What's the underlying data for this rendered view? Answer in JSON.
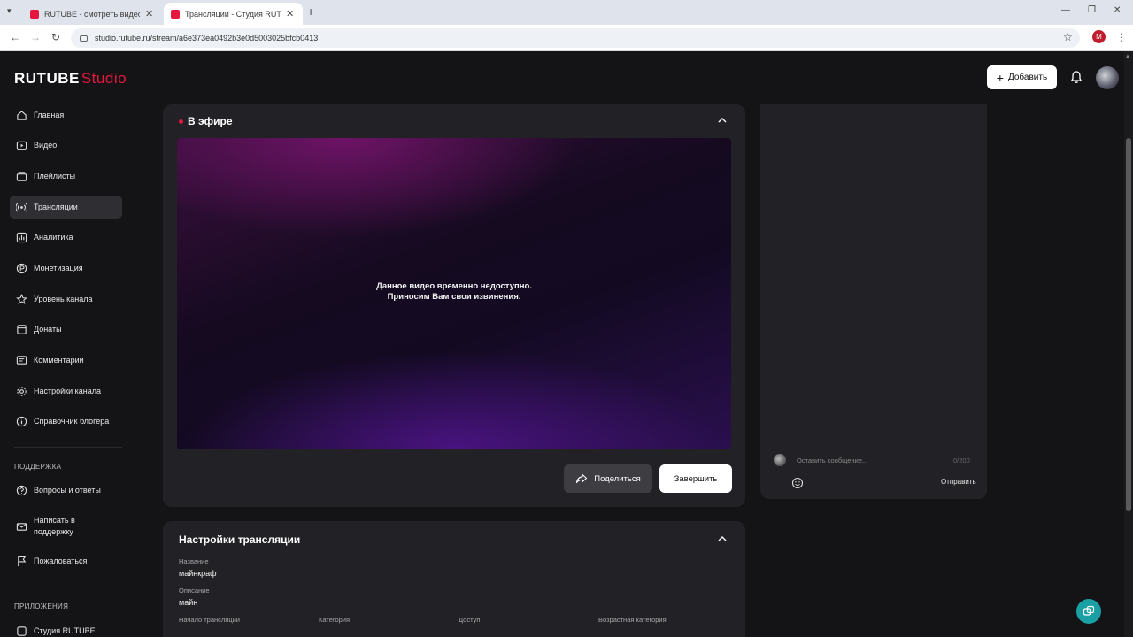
{
  "browser": {
    "tabs": [
      {
        "title": "RUTUBE - смотреть видео онлайн",
        "active": false
      },
      {
        "title": "Трансляции - Студия RUTUBE",
        "active": true
      }
    ],
    "url": "studio.rutube.ru/stream/a6e373ea0492b3e0d5003025bfcb0413",
    "profile_initial": "M"
  },
  "header": {
    "logo_main": "RUTUBE",
    "logo_studio": "Studio",
    "add_label": "Добавить"
  },
  "sidebar": {
    "items": [
      {
        "label": "Главная",
        "icon": "home-icon"
      },
      {
        "label": "Видео",
        "icon": "video-icon"
      },
      {
        "label": "Плейлисты",
        "icon": "playlist-icon"
      },
      {
        "label": "Трансляции",
        "icon": "broadcast-icon",
        "active": true
      },
      {
        "label": "Аналитика",
        "icon": "analytics-icon"
      },
      {
        "label": "Монетизация",
        "icon": "monetization-icon"
      },
      {
        "label": "Уровень канала",
        "icon": "star-icon"
      },
      {
        "label": "Донаты",
        "icon": "donate-icon"
      },
      {
        "label": "Комментарии",
        "icon": "comments-icon"
      },
      {
        "label": "Настройки канала",
        "icon": "gear-icon"
      },
      {
        "label": "Справочник блогера",
        "icon": "info-icon"
      }
    ],
    "support_title": "ПОДДЕРЖКА",
    "support_items": [
      {
        "label": "Вопросы и ответы",
        "icon": "help-icon"
      },
      {
        "label_line1": "Написать в",
        "label_line2": "поддержку",
        "icon": "mail-icon"
      },
      {
        "label": "Пожаловаться",
        "icon": "flag-icon"
      }
    ],
    "apps_title": "ПРИЛОЖЕНИЯ",
    "apps_items": [
      {
        "label": "Студия RUTUBE",
        "icon": "app-icon"
      }
    ]
  },
  "live": {
    "title": "В эфире",
    "message_line1": "Данное видео временно недоступно.",
    "message_line2": "Приносим Вам свои извинения.",
    "share_label": "Поделиться",
    "end_label": "Завершить"
  },
  "chat": {
    "placeholder": "Оставить сообщение...",
    "counter": "0/200",
    "send_label": "Отправить"
  },
  "settings": {
    "title": "Настройки трансляции",
    "name_label": "Название",
    "name_value": "майнкраф",
    "description_label": "Описание",
    "description_value": "майн",
    "start_label": "Начало трансляции",
    "category_label": "Категория",
    "access_label": "Доступ",
    "age_label": "Возрастная категория"
  },
  "colors": {
    "accent": "#e5173f",
    "background": "#141416",
    "panel": "#222226",
    "support_fab": "#1aa0a4"
  }
}
